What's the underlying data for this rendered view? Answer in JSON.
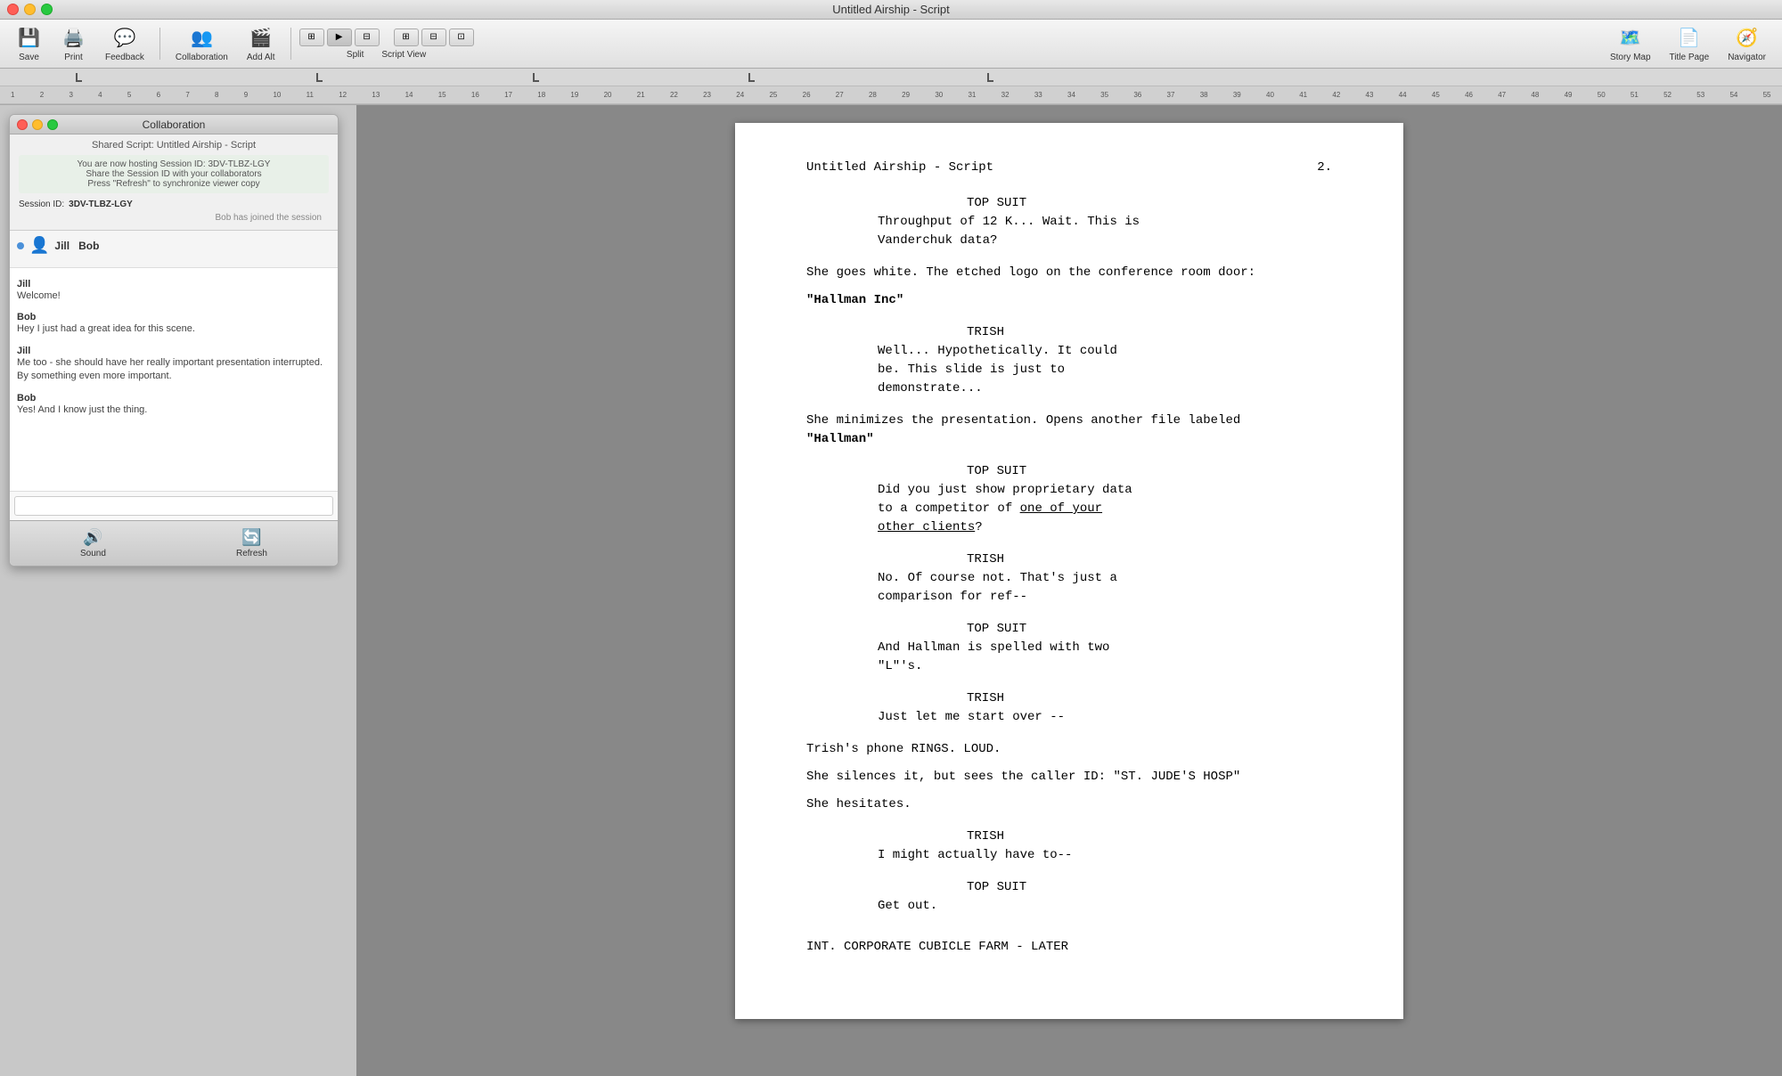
{
  "window": {
    "title": "Untitled Airship - Script"
  },
  "toolbar": {
    "save_label": "Save",
    "print_label": "Print",
    "feedback_label": "Feedback",
    "collaboration_label": "Collaboration",
    "add_alt_label": "Add Alt",
    "split_label": "Split",
    "script_view_label": "Script View",
    "story_map_label": "Story Map",
    "title_page_label": "Title Page",
    "navigator_label": "Navigator"
  },
  "collaboration": {
    "window_title": "Collaboration",
    "shared_label": "Shared Script: Untitled Airship - Script",
    "session_info_line1": "You are now hosting Session ID: 3DV-TLBZ-LGY",
    "session_info_line2": "Share the Session ID with your collaborators",
    "session_info_line3": "Press \"Refresh\" to synchronize viewer copy",
    "session_id_label": "Session ID:",
    "session_id_value": "3DV-TLBZ-LGY",
    "bob_joined": "Bob has joined the session",
    "jill_username": "Jill",
    "bob_username": "Bob",
    "messages": [
      {
        "sender": "Jill",
        "text": "Welcome!"
      },
      {
        "sender": "Bob",
        "text": "Hey I just had a great idea for this scene."
      },
      {
        "sender": "Jill",
        "text": "Me too - she should have her really important presentation interrupted. By something even more important."
      },
      {
        "sender": "Bob",
        "text": "Yes! And I know just the thing."
      }
    ],
    "sound_label": "Sound",
    "refresh_label": "Refresh"
  },
  "script": {
    "title": "Untitled Airship - Script",
    "page_number": "2.",
    "content": [
      {
        "type": "character",
        "text": "TOP SUIT"
      },
      {
        "type": "dialogue",
        "text": "Throughput of 12 K... Wait. This is Vanderchuk data?"
      },
      {
        "type": "action",
        "text": "She goes white. The etched logo on the conference room door:"
      },
      {
        "type": "action_bold",
        "text": "\"Hallman Inc\""
      },
      {
        "type": "character",
        "text": "TRISH"
      },
      {
        "type": "dialogue",
        "text": "Well... Hypothetically. It could be. This slide is just to demonstrate..."
      },
      {
        "type": "action",
        "text": "She minimizes the presentation. Opens another file labeled"
      },
      {
        "type": "action_bold",
        "text": "\"Hallman\""
      },
      {
        "type": "character",
        "text": "TOP SUIT"
      },
      {
        "type": "dialogue",
        "text": "Did you just show proprietary data to a competitor of one of your other clients?"
      },
      {
        "type": "character",
        "text": "TRISH"
      },
      {
        "type": "dialogue",
        "text": "No. Of course not. That's just a comparison for ref--"
      },
      {
        "type": "character",
        "text": "TOP SUIT"
      },
      {
        "type": "dialogue",
        "text": "And Hallman is spelled with two \"L\"'s."
      },
      {
        "type": "character",
        "text": "TRISH"
      },
      {
        "type": "dialogue",
        "text": "Just let me start over --"
      },
      {
        "type": "action",
        "text": "Trish's phone RINGS. LOUD."
      },
      {
        "type": "action",
        "text": "She silences it, but sees the caller ID: \"ST. JUDE'S HOSP\""
      },
      {
        "type": "action",
        "text": "She hesitates."
      },
      {
        "type": "character",
        "text": "TRISH"
      },
      {
        "type": "dialogue",
        "text": "I might actually have to--"
      },
      {
        "type": "character",
        "text": "TOP SUIT"
      },
      {
        "type": "dialogue",
        "text": "Get out."
      },
      {
        "type": "scene_heading",
        "text": "INT. CORPORATE CUBICLE FARM - LATER"
      }
    ]
  }
}
